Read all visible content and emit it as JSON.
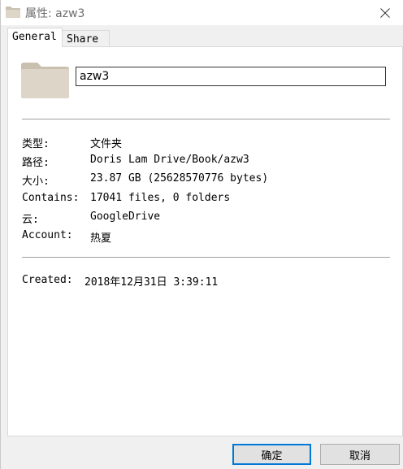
{
  "window": {
    "title": "属性: azw3",
    "colors": {
      "accent": "#0078d7",
      "folder": "#dcd5c8",
      "folder_dark": "#c9c0b0"
    }
  },
  "tabs": [
    {
      "label": "General",
      "active": true
    },
    {
      "label": "Share",
      "active": false
    }
  ],
  "folder_name": "azw3",
  "properties": [
    {
      "label": "类型:",
      "value": "文件夹"
    },
    {
      "label": "路径:",
      "value": "Doris Lam Drive/Book/azw3"
    },
    {
      "label": "大小:",
      "value": "23.87 GB (25628570776 bytes)"
    },
    {
      "label": "Contains:",
      "value": "17041 files, 0 folders"
    },
    {
      "label": "云:",
      "value": "GoogleDrive"
    },
    {
      "label": "Account:",
      "value": "热夏"
    }
  ],
  "created": {
    "label": "Created:",
    "value": "2018年12月31日 3:39:11"
  },
  "buttons": {
    "ok": "确定",
    "cancel": "取消"
  },
  "icons": {
    "title": "folder-icon",
    "close": "close-icon",
    "large": "folder-icon"
  }
}
